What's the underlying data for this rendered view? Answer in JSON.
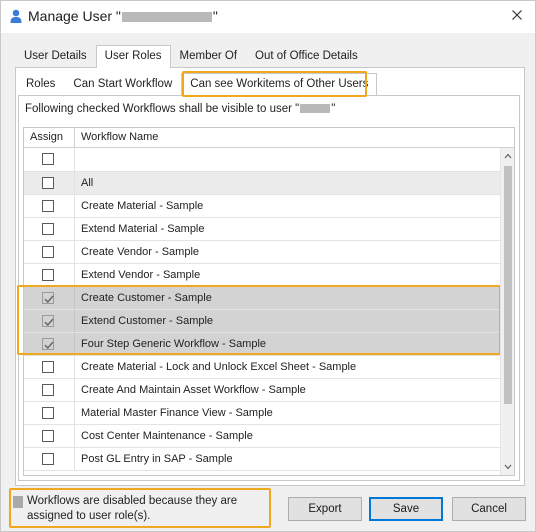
{
  "window": {
    "title_prefix": "Manage User \"",
    "title_suffix": "\""
  },
  "outer_tabs": [
    "User Details",
    "User Roles",
    "Member Of",
    "Out of Office Details"
  ],
  "inner_tabs": [
    "Roles",
    "Can Start Workflow",
    "Can see Workitems of Other Users"
  ],
  "description": {
    "prefix": "Following checked Workflows shall be visible to user \"",
    "suffix": "\""
  },
  "grid": {
    "columns": [
      "Assign",
      "Workflow Name"
    ],
    "rows": [
      {
        "name": "All",
        "checked": false,
        "disabled": false
      },
      {
        "name": "Create Material - Sample",
        "checked": false,
        "disabled": false
      },
      {
        "name": "Extend Material - Sample",
        "checked": false,
        "disabled": false
      },
      {
        "name": "Create Vendor - Sample",
        "checked": false,
        "disabled": false
      },
      {
        "name": "Extend Vendor - Sample",
        "checked": false,
        "disabled": false
      },
      {
        "name": "Create Customer - Sample",
        "checked": true,
        "disabled": true
      },
      {
        "name": "Extend Customer - Sample",
        "checked": true,
        "disabled": true
      },
      {
        "name": "Four Step Generic Workflow - Sample",
        "checked": true,
        "disabled": true
      },
      {
        "name": "Create Material - Lock and Unlock Excel Sheet - Sample",
        "checked": false,
        "disabled": false
      },
      {
        "name": "Create And Maintain Asset Workflow - Sample",
        "checked": false,
        "disabled": false
      },
      {
        "name": "Material Master Finance View - Sample",
        "checked": false,
        "disabled": false
      },
      {
        "name": "Cost Center Maintenance - Sample",
        "checked": false,
        "disabled": false
      },
      {
        "name": "Post GL Entry in SAP - Sample",
        "checked": false,
        "disabled": false
      }
    ]
  },
  "footer": {
    "legend_text": "Workflows are disabled because they are assigned to user role(s).",
    "export_label": "Export",
    "save_label": "Save",
    "cancel_label": "Cancel"
  },
  "colors": {
    "highlight": "#f0a81f",
    "disabled_row": "#d3d3d3",
    "all_row": "#ebebeb"
  }
}
